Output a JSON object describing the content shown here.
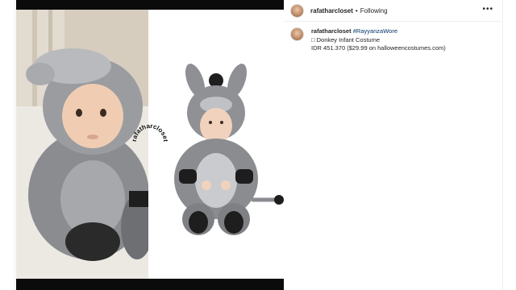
{
  "post": {
    "username": "rafatharcloset",
    "separator": "•",
    "follow_status": "Following",
    "more_icon": "more-horizontal-icon",
    "caption": {
      "username": "rafatharcloset",
      "hashtag": "#RayyanzaWore",
      "line2": "□ Donkey Infant Costume",
      "line3": "IDR 451.370 ($29.99 on halloweencostumes.com)"
    }
  },
  "media": {
    "watermark_text": "rafatharcloset"
  },
  "colors": {
    "text": "#262626",
    "hashtag": "#003569",
    "divider": "#efefef",
    "letterbox": "#0b0b0b"
  }
}
